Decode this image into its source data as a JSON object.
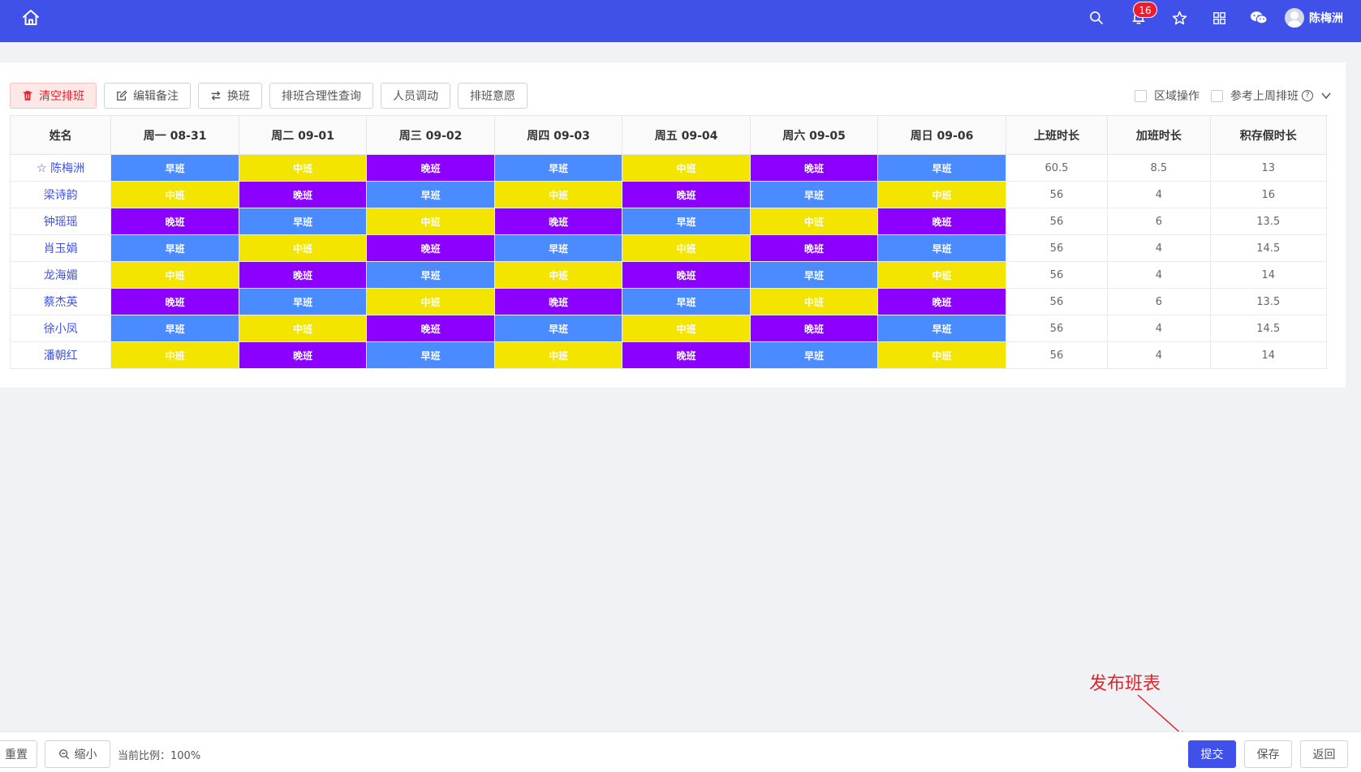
{
  "header": {
    "notification_count": "16",
    "user_name": "陈梅洲",
    "icons": [
      "home-icon",
      "search-icon",
      "bell-icon",
      "star-icon",
      "grid-icon",
      "wechat-icon",
      "user-avatar-icon"
    ]
  },
  "toolbar": {
    "clear": "清空排班",
    "edit_note": "编辑备注",
    "swap": "换班",
    "check": "排班合理性查询",
    "transfer": "人员调动",
    "wish": "排班意愿",
    "region_op": "区域操作",
    "ref_last_week": "参考上周排班"
  },
  "table": {
    "headers": [
      "姓名",
      "周一 08-31",
      "周二 09-01",
      "周三 09-02",
      "周四 09-03",
      "周五 09-04",
      "周六 09-05",
      "周日 09-06",
      "上班时长",
      "加班时长",
      "积存假时长"
    ],
    "rows": [
      {
        "name": "☆ 陈梅洲",
        "shifts": [
          "早班",
          "中班",
          "晚班",
          "早班",
          "中班",
          "晚班",
          "早班"
        ],
        "work": "60.5",
        "overtime": "8.5",
        "leave": "13"
      },
      {
        "name": "梁诗韵",
        "shifts": [
          "中班",
          "晚班",
          "早班",
          "中班",
          "晚班",
          "早班",
          "中班"
        ],
        "work": "56",
        "overtime": "4",
        "leave": "16"
      },
      {
        "name": "钟瑶瑶",
        "shifts": [
          "晚班",
          "早班",
          "中班",
          "晚班",
          "早班",
          "中班",
          "晚班"
        ],
        "work": "56",
        "overtime": "6",
        "leave": "13.5"
      },
      {
        "name": "肖玉娟",
        "shifts": [
          "早班",
          "中班",
          "晚班",
          "早班",
          "中班",
          "晚班",
          "早班"
        ],
        "work": "56",
        "overtime": "4",
        "leave": "14.5"
      },
      {
        "name": "龙海媚",
        "shifts": [
          "中班",
          "晚班",
          "早班",
          "中班",
          "晚班",
          "早班",
          "中班"
        ],
        "work": "56",
        "overtime": "4",
        "leave": "14"
      },
      {
        "name": "蔡杰英",
        "shifts": [
          "晚班",
          "早班",
          "中班",
          "晚班",
          "早班",
          "中班",
          "晚班"
        ],
        "work": "56",
        "overtime": "6",
        "leave": "13.5"
      },
      {
        "name": "徐小凤",
        "shifts": [
          "早班",
          "中班",
          "晚班",
          "早班",
          "中班",
          "晚班",
          "早班"
        ],
        "work": "56",
        "overtime": "4",
        "leave": "14.5"
      },
      {
        "name": "潘朝红",
        "shifts": [
          "中班",
          "晚班",
          "早班",
          "中班",
          "晚班",
          "早班",
          "中班"
        ],
        "work": "56",
        "overtime": "4",
        "leave": "14"
      }
    ]
  },
  "shift_colors": {
    "早班": "#4a8cff",
    "中班": "#f3e500",
    "晚班": "#8b00ff"
  },
  "bottom": {
    "reset": "重置",
    "zoom_out": "缩小",
    "zoom_label": "当前比例：100%",
    "submit": "提交",
    "save": "保存",
    "back": "返回"
  },
  "annotation": "发布班表"
}
